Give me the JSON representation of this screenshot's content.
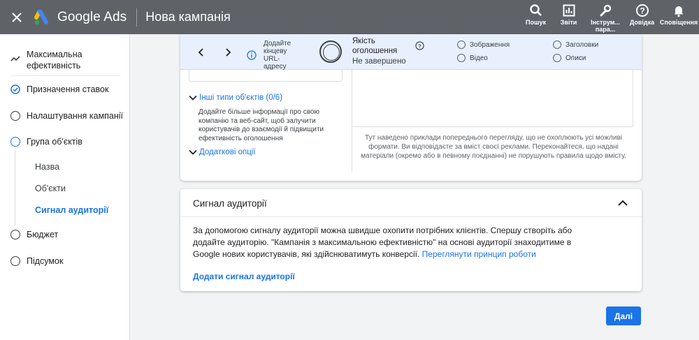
{
  "topbar": {
    "app_name": "Google Ads",
    "page_title": "Нова кампанія",
    "actions": [
      {
        "label": "Пошук",
        "icon": "search-icon"
      },
      {
        "label": "Звіти",
        "icon": "reports-icon"
      },
      {
        "label": "Інструм... пара...",
        "label_line1": "Інструм...",
        "label_line2": "пара...",
        "icon": "wrench-icon"
      },
      {
        "label": "Довідка",
        "icon": "help-icon"
      },
      {
        "label": "Сповіщення",
        "icon": "bell-icon"
      }
    ]
  },
  "sidebar": {
    "items": [
      {
        "label": "Максимальна ефективність",
        "line1": "Максимальна",
        "line2": "ефективність",
        "state": "trend"
      },
      {
        "label": "Призначення ставок",
        "state": "done"
      },
      {
        "label": "Налаштування кампанії",
        "state": "empty"
      },
      {
        "label": "Група об'єктів",
        "state": "current"
      },
      {
        "label": "Бюджет",
        "state": "empty"
      },
      {
        "label": "Підсумок",
        "state": "empty"
      }
    ],
    "subitems": [
      {
        "label": "Назва",
        "active": false
      },
      {
        "label": "Об'єкти",
        "active": false
      },
      {
        "label": "Сигнал аудиторії",
        "active": true
      }
    ]
  },
  "ad_quality": {
    "hint_line1": "Додайте",
    "hint_line2": "кінцеву",
    "hint_line3": "URL-",
    "hint_line4": "адресу",
    "label_line1": "Якість",
    "label_line2": "оголошення",
    "status": "Не завершено",
    "assets": [
      "Зображення",
      "Заголовки",
      "Відео",
      "Описи"
    ]
  },
  "asset_group": {
    "other_types_label": "Інші типи об'єктів (0/6)",
    "other_types_desc": "Додайте більше інформації про свою компанію та веб-сайт, щоб залучити користувачів до взаємодії й підвищити ефективність оголошення",
    "extra_options_label": "Додаткові опції",
    "preview_note": "Тут наведено приклади попереднього перегляду, що не охоплюють усі можливі формати. Ви відповідаєте за вміст своєї реклами. Переконайтеся, що надані матеріали (окремо або в певному поєднанні) не порушують правила щодо вмісту."
  },
  "audience_signal": {
    "title": "Сигнал аудиторії",
    "body": "За допомогою сигналу аудиторії можна швидше охопити потрібних клієнтів. Спершу створіть або додайте аудиторію. \"Кампанія з максимальною ефективністю\" на основі аудиторії знаходитиме в Google нових користувачів, які здійснюватимуть конверсії.",
    "link": "Переглянути принцип роботи",
    "add_button": "Додати сигнал аудиторії"
  },
  "next_button": "Далі",
  "colors": {
    "accent": "#1a73e8",
    "topbar": "#5f6368",
    "quality_bar": "#e8f0fe"
  }
}
